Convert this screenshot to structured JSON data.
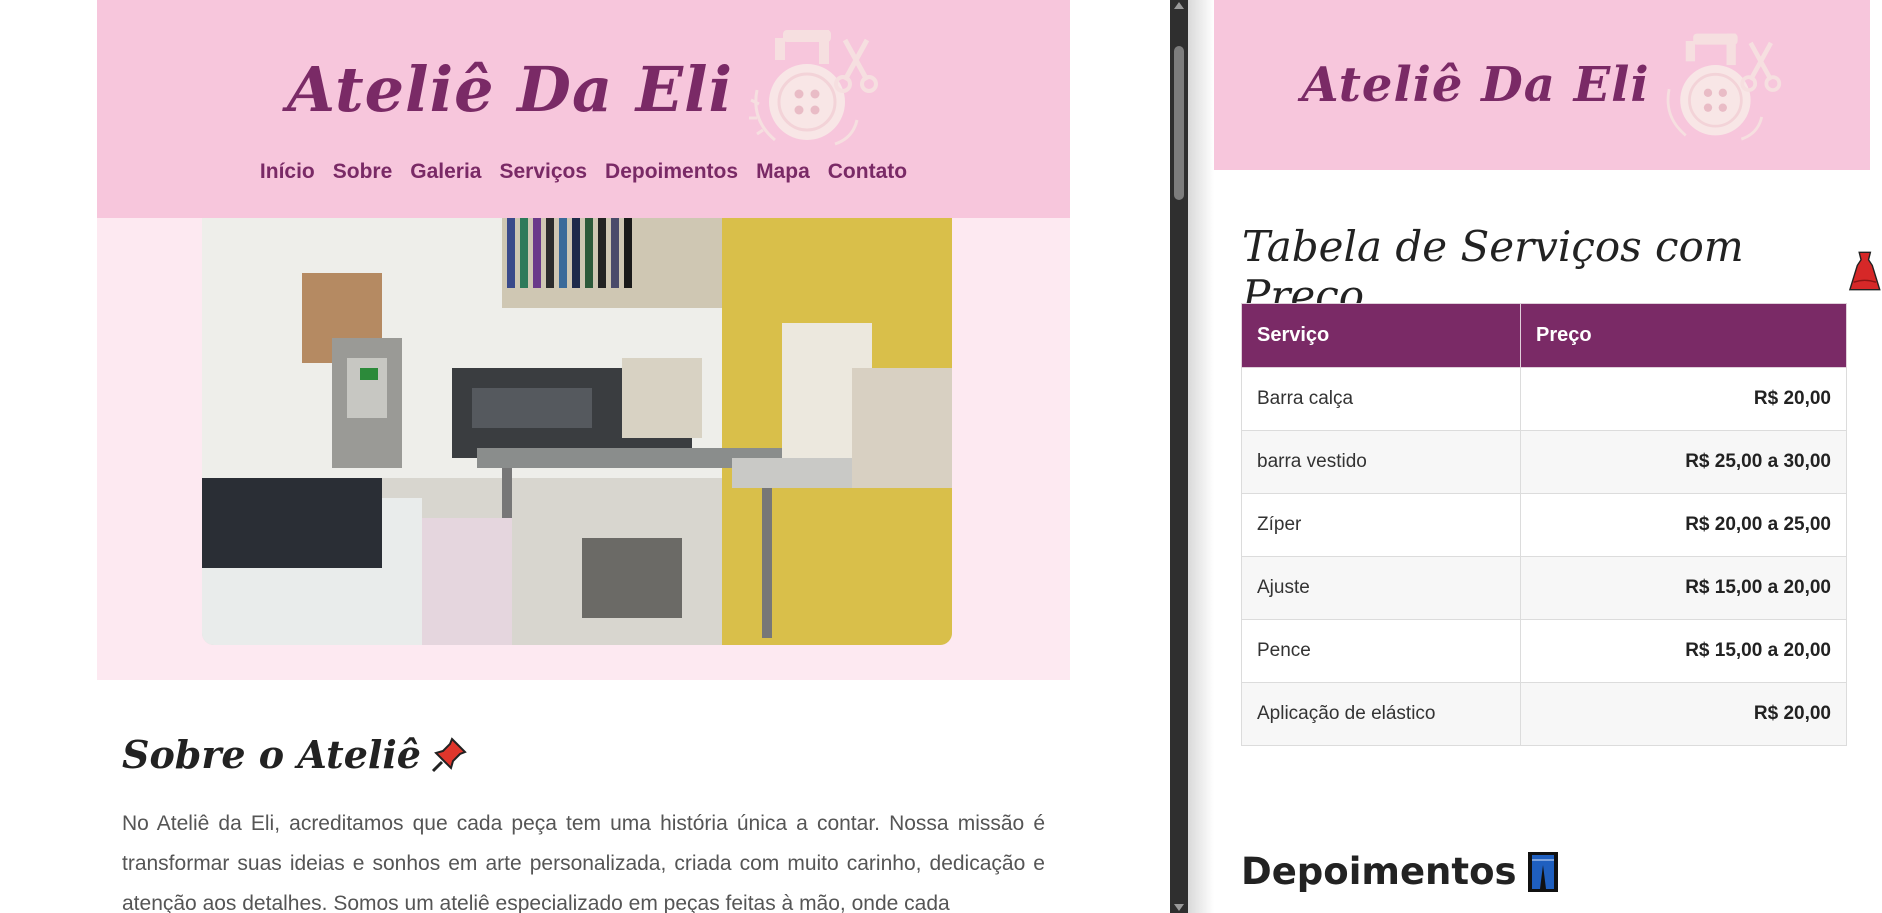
{
  "left": {
    "brand": {
      "title": "Ateliê Da Eli"
    },
    "nav": [
      {
        "label": "Início"
      },
      {
        "label": "Sobre"
      },
      {
        "label": "Galeria"
      },
      {
        "label": "Serviços"
      },
      {
        "label": "Depoimentos"
      },
      {
        "label": "Mapa"
      },
      {
        "label": "Contato"
      }
    ],
    "about": {
      "title": "Sobre o Ateliê",
      "text": "No Ateliê da Eli, acreditamos que cada peça tem uma história única a contar. Nossa missão é transformar suas ideias e sonhos em arte personalizada, criada com muito carinho, dedicação e atenção aos detalhes. Somos um ateliê especializado em peças feitas à mão, onde cada"
    }
  },
  "right": {
    "brand": {
      "title": "Ateliê Da Eli"
    },
    "services": {
      "title": "Tabela de Serviços com Preço",
      "columns": [
        "Serviço",
        "Preço"
      ],
      "rows": [
        {
          "service": "Barra calça",
          "price": "R$ 20,00"
        },
        {
          "service": "barra vestido",
          "price": "R$ 25,00 a 30,00"
        },
        {
          "service": "Zíper",
          "price": "R$ 20,00 a 25,00"
        },
        {
          "service": "Ajuste",
          "price": "R$ 15,00 a 20,00"
        },
        {
          "service": "Pence",
          "price": "R$ 15,00 a 20,00"
        },
        {
          "service": "Aplicação de elástico",
          "price": "R$ 20,00"
        }
      ]
    },
    "testimonials": {
      "title": "Depoimentos"
    }
  },
  "icons": {
    "logo": "sewing-button-logo-icon",
    "pin": "pushpin-icon",
    "dress": "dress-icon",
    "jeans": "jeans-icon"
  },
  "colors": {
    "header_pink": "#f7c6dc",
    "hero_pink": "#fde9f1",
    "brand_purple": "#7a2a66"
  }
}
